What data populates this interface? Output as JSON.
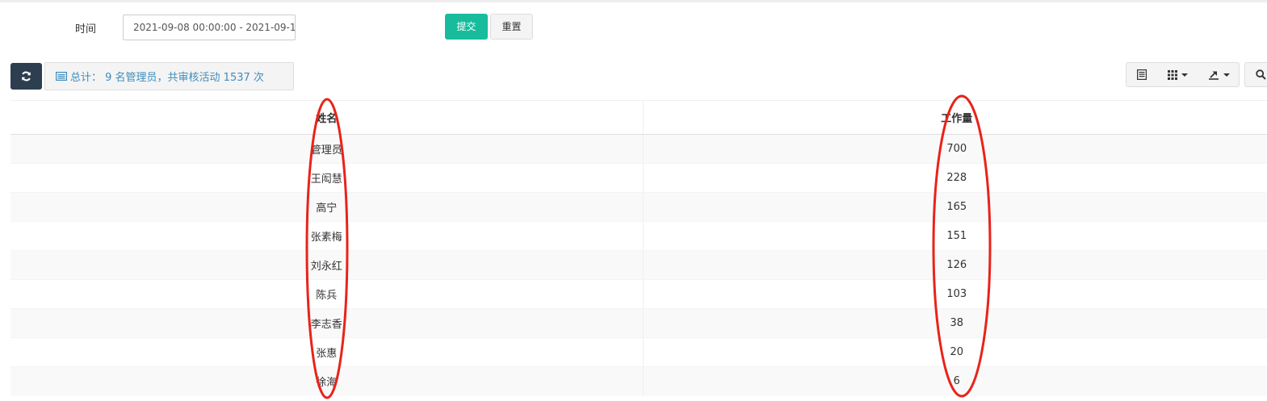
{
  "filter": {
    "time_label": "时间",
    "time_value": "2021-09-08 00:00:00 - 2021-09-1",
    "submit_label": "提交",
    "reset_label": "重置"
  },
  "toolbar": {
    "summary_text": "总计： 9 名管理员，共审核活动 1537 次"
  },
  "table": {
    "columns": [
      "姓名",
      "工作量"
    ],
    "rows": [
      {
        "name": "管理员",
        "workload": "700"
      },
      {
        "name": "王闳慧",
        "workload": "228"
      },
      {
        "name": "高宁",
        "workload": "165"
      },
      {
        "name": "张素梅",
        "workload": "151"
      },
      {
        "name": "刘永红",
        "workload": "126"
      },
      {
        "name": "陈兵",
        "workload": "103"
      },
      {
        "name": "李志香",
        "workload": "38"
      },
      {
        "name": "张惠",
        "workload": "20"
      },
      {
        "name": "徐海",
        "workload": "6"
      }
    ]
  },
  "colors": {
    "submit": "#18bc9c",
    "refresh": "#2c3e50",
    "summary_text": "#3c8dbc",
    "annotation": "#e8231a"
  },
  "icons": {
    "refresh": "refresh-icon",
    "summary": "list-icon",
    "toggle_view": "table-view-icon",
    "columns": "grid-columns-icon",
    "export": "export-icon",
    "search": "search-icon"
  }
}
